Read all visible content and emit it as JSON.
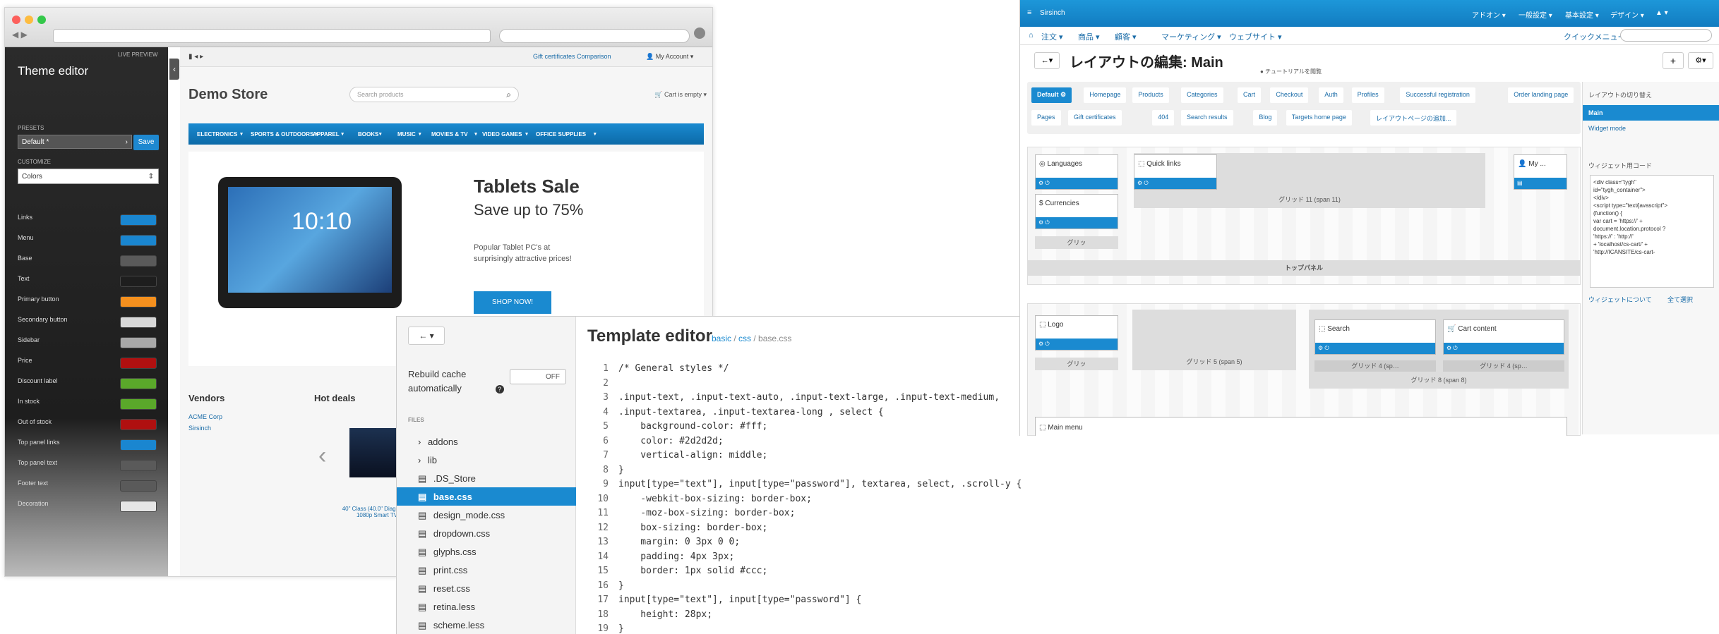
{
  "theme_editor": {
    "title": "Theme editor",
    "live_preview": "LIVE PREVIEW",
    "presets_label": "PRESETS",
    "preset_value": "Default *",
    "save_label": "Save",
    "customize_label": "CUSTOMIZE",
    "customize_value": "Colors",
    "rows": [
      {
        "label": "Links",
        "color": "#1a86d0"
      },
      {
        "label": "Menu",
        "color": "#1a86d0"
      },
      {
        "label": "Base",
        "color": "#5a5a5a"
      },
      {
        "label": "Text",
        "color": "#1e1e1e"
      },
      {
        "label": "Primary button",
        "color": "#f5901e"
      },
      {
        "label": "Secondary button",
        "color": "#d8d8d8"
      },
      {
        "label": "Sidebar",
        "color": "#a8a8a8"
      },
      {
        "label": "Price",
        "color": "#b01010"
      },
      {
        "label": "Discount label",
        "color": "#5aa82a"
      },
      {
        "label": "In stock",
        "color": "#5aa82a"
      },
      {
        "label": "Out of stock",
        "color": "#b01010"
      },
      {
        "label": "Top panel links",
        "color": "#1a86d0"
      },
      {
        "label": "Top panel text",
        "color": "#5a5a5a"
      },
      {
        "label": "Footer text",
        "color": "#5a5a5a"
      },
      {
        "label": "Decoration",
        "color": "#e6e6e6"
      }
    ]
  },
  "store": {
    "top_links": "Gift certificates   Comparison",
    "account": "My Account",
    "logo": "Demo Store",
    "search_placeholder": "Search products",
    "cart": "Cart is empty",
    "nav": [
      "ELECTRONICS",
      "SPORTS & OUTDOORS",
      "APPAREL",
      "BOOKS",
      "MUSIC",
      "MOVIES & TV",
      "VIDEO GAMES",
      "OFFICE SUPPLIES"
    ],
    "banner_title": "Tablets Sale",
    "banner_subtitle": "Save up to 75%",
    "banner_text": "Popular Tablet PC's at surprisingly attractive prices!",
    "banner_button": "SHOP NOW!",
    "tablet_time": "10:10",
    "vendors_heading": "Vendors",
    "vendors": [
      "ACME Corp",
      "Sirsinch"
    ],
    "hot_deals_heading": "Hot deals",
    "product_caption": "40\" Class (40.0\" Diag.) LED 1080p Smart TV"
  },
  "template_editor": {
    "back_label": "←  ▾",
    "title": "Template editor",
    "breadcrumb_base": "basic",
    "breadcrumb_css": "css",
    "breadcrumb_file": "base.css",
    "rebuild_label": "Rebuild cache automatically",
    "toggle_label": "OFF",
    "files_label": "FILES",
    "files": [
      {
        "name": "addons",
        "type": "folder"
      },
      {
        "name": "lib",
        "type": "folder"
      },
      {
        "name": ".DS_Store",
        "type": "file"
      },
      {
        "name": "base.css",
        "type": "file",
        "active": true
      },
      {
        "name": "design_mode.css",
        "type": "file"
      },
      {
        "name": "dropdown.css",
        "type": "file"
      },
      {
        "name": "glyphs.css",
        "type": "file"
      },
      {
        "name": "print.css",
        "type": "file"
      },
      {
        "name": "reset.css",
        "type": "file"
      },
      {
        "name": "retina.less",
        "type": "file"
      },
      {
        "name": "scheme.less",
        "type": "file"
      }
    ],
    "code_lines": [
      "/* General styles */",
      "",
      ".input-text, .input-text-auto, .input-text-large, .input-text-medium,",
      ".input-textarea, .input-textarea-long , select {",
      "    background-color: #fff;",
      "    color: #2d2d2d;",
      "    vertical-align: middle;",
      "}",
      "input[type=\"text\"], input[type=\"password\"], textarea, select, .scroll-y {",
      "    -webkit-box-sizing: border-box;",
      "    -moz-box-sizing: border-box;",
      "    box-sizing: border-box;",
      "    margin: 0 3px 0 0;",
      "    padding: 4px 3px;",
      "    border: 1px solid #ccc;",
      "}",
      "input[type=\"text\"], input[type=\"password\"] {",
      "    height: 28px;",
      "}"
    ]
  },
  "layout_admin": {
    "brand": "Sirsinch",
    "top_menu": [
      "アドオン ▾",
      "一般設定 ▾",
      "基本設定 ▾",
      "デザイン ▾",
      "▲ ▾"
    ],
    "menu": [
      "注文 ▾",
      "商品 ▾",
      "顧客 ▾",
      "マーケティング ▾",
      "ウェブサイト ▾"
    ],
    "quick_menu": "クイックメニュー",
    "heading": "レイアウトの編集: Main",
    "tutorial": "チュートリアルを閲覧",
    "tabs_row1": [
      "Default ⚙",
      "Homepage",
      "Products",
      "Categories",
      "Cart",
      "Checkout",
      "Auth",
      "Profiles",
      "Successful registration",
      "Order landing page"
    ],
    "tabs_row2": [
      "Pages",
      "Gift certificates",
      "404",
      "Search results",
      "Blog",
      "Targets home page",
      "レイアウトページの追加..."
    ],
    "blocks": {
      "languages": "Languages",
      "quick_links": "Quick links",
      "my": "My ...",
      "currencies": "Currencies",
      "grid_span11": "グリッド 11 (span 11)",
      "grid": "グリッ",
      "top_panel": "トップパネル",
      "logo": "Logo",
      "grid_span5": "グリッド 5 (span 5)",
      "search": "Search",
      "cart_content": "Cart content",
      "grid_span4a": "グリッド 4 (sp…",
      "grid_span4b": "グリッド 4 (sp…",
      "grid_span8": "グリッド 8 (span 8)",
      "main_menu": "Main menu"
    },
    "side_title": "レイアウトの切り替え",
    "side_items": [
      "Main",
      "Widget mode"
    ],
    "widget_code_label": "ウィジェット用コード",
    "widget_code": "<div class=\"tygh\"\nid=\"tygh_container\">\n</div>\n<script type=\"text/javascript\">\n(function() {\nvar cart = 'https://' +\ndocument.location.protocol ?\n'https://' : 'http://'\n+ 'localhost/cs-cart/' +\n'http://ICANSITE/cs-cart-",
    "widget_about": "ウィジェットについて",
    "widget_all": "全て選択"
  }
}
